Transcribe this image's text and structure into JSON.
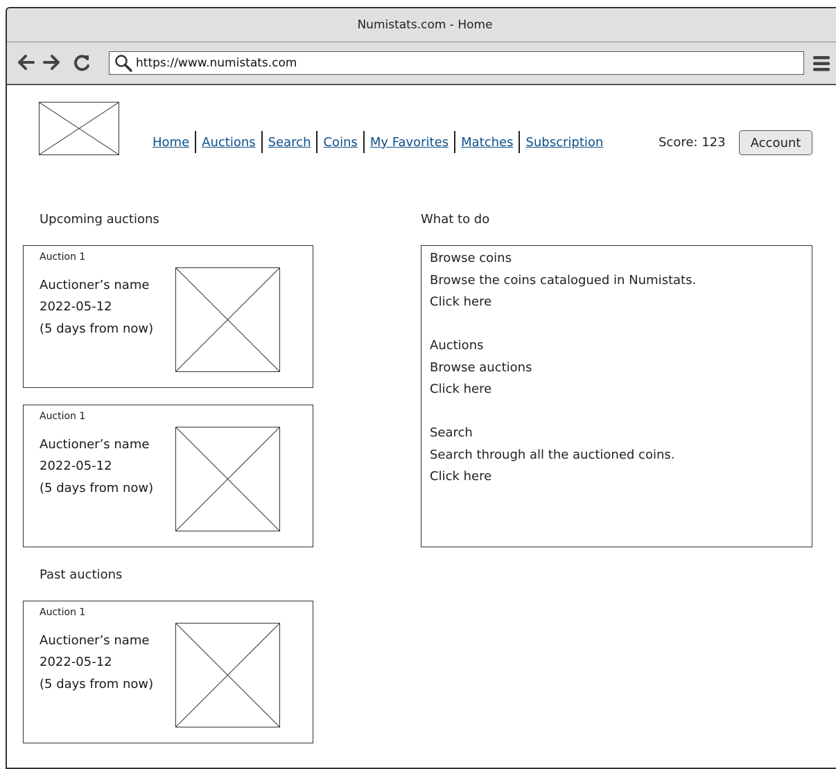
{
  "browser": {
    "window_title": "Numistats.com - Home",
    "url": "https://www.numistats.com"
  },
  "header": {
    "nav": [
      "Home",
      "Auctions",
      "Search",
      "Coins",
      "My Favorites",
      "Matches",
      "Subscription"
    ],
    "score": "Score: 123",
    "account_label": "Account"
  },
  "upcoming": {
    "title": "Upcoming auctions",
    "cards": [
      {
        "title": "Auction 1",
        "auctioneer": "Auctioner’s name",
        "date": "2022-05-12",
        "relative": "(5 days from now)"
      },
      {
        "title": "Auction 1",
        "auctioneer": "Auctioner’s name",
        "date": "2022-05-12",
        "relative": "(5 days from now)"
      }
    ]
  },
  "past": {
    "title": "Past auctions",
    "cards": [
      {
        "title": "Auction 1",
        "auctioneer": "Auctioner’s name",
        "date": "2022-05-12",
        "relative": "(5 days from now)"
      }
    ]
  },
  "todo": {
    "title": "What to do",
    "items": [
      {
        "heading": "Browse coins",
        "description": "Browse the coins catalogued in Numistats.",
        "link": "Click here"
      },
      {
        "heading": "Auctions",
        "description": "Browse auctions",
        "link": "Click here"
      },
      {
        "heading": "Search",
        "description": "Search through all the auctioned coins.",
        "link": "Click here"
      }
    ]
  }
}
